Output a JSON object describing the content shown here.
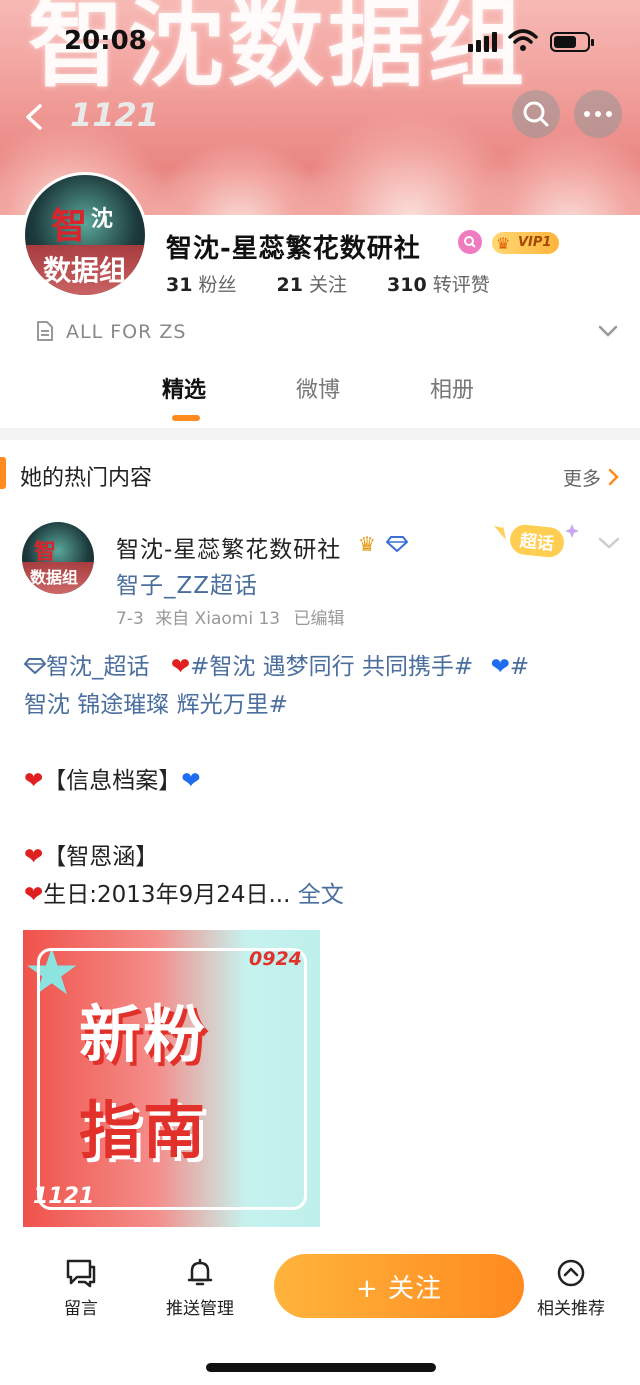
{
  "status": {
    "time": "20:08"
  },
  "banner": {
    "title_text": "智沈数据组",
    "tag_text": "1121"
  },
  "profile": {
    "name": "智沈-星蕊繁花数研社",
    "vip": "VIP1",
    "fans_count": "31",
    "fans_label": "粉丝",
    "follow_count": "21",
    "follow_label": "关注",
    "interactions_count": "310",
    "interactions_label": "转评赞",
    "bio": "ALL FOR ZS"
  },
  "tabs": [
    {
      "label": "精选",
      "active": true
    },
    {
      "label": "微博",
      "active": false
    },
    {
      "label": "相册",
      "active": false
    }
  ],
  "hot": {
    "title": "她的热门内容",
    "more": "更多"
  },
  "post": {
    "author": "智沈-星蕊繁花数研社",
    "topic": "智子_ZZ超话",
    "time": "7-3",
    "source": "来自 Xiaomi 13",
    "edited": "已编辑",
    "super_tag": "超话",
    "body_line1_link1": "智沈_超话",
    "body_line1_link2": "#智沈 遇梦同行 共同携手#",
    "body_line1_link3": "#",
    "body_line2_link": "智沈 锦途璀璨 辉光万里#",
    "body_info": "【信息档案】",
    "body_name": "【智恩涵】",
    "body_birthday": "生日:2013年9月24日...",
    "expand": "全文",
    "image": {
      "line1": "新粉",
      "line2": "指南",
      "number": "0924",
      "signature": "1121"
    }
  },
  "bottom": {
    "comment": "留言",
    "push": "推送管理",
    "follow": "+ 关注",
    "related": "相关推荐"
  },
  "colors": {
    "accent": "#ff8a1f",
    "link": "#4a6e9e",
    "heart_red": "#e02020",
    "heart_blue": "#1e6df0"
  }
}
